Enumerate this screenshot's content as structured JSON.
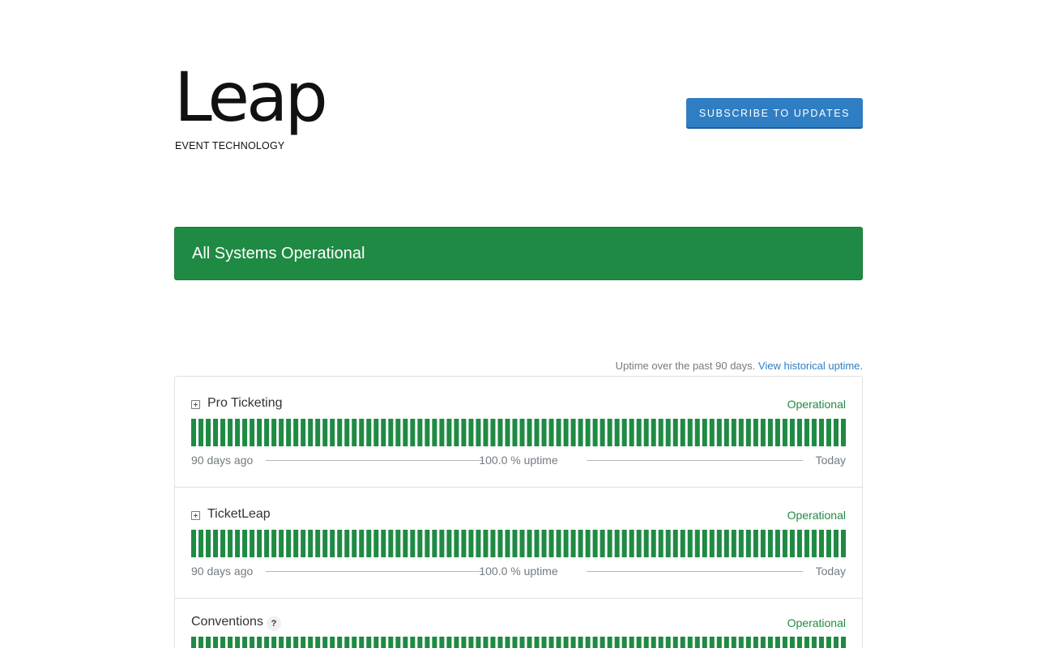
{
  "brand": {
    "logo_word": "Leap",
    "logo_sub": "EVENT TECHNOLOGY"
  },
  "header": {
    "subscribe_label": "SUBSCRIBE TO UPDATES"
  },
  "status": {
    "message": "All Systems Operational",
    "color": "#1f8a43"
  },
  "uptime": {
    "caption": "Uptime over the past 90 days.",
    "link_label": "View historical uptime."
  },
  "colors": {
    "operational": "#1f8a43",
    "accent": "#2f7ec4"
  },
  "components": [
    {
      "name": "Pro Ticketing",
      "status": "Operational",
      "expandable": true,
      "has_help": false,
      "days": 90,
      "left_label": "90 days ago",
      "uptime_label": "100.0 % uptime",
      "right_label": "Today"
    },
    {
      "name": "TicketLeap",
      "status": "Operational",
      "expandable": true,
      "has_help": false,
      "days": 90,
      "left_label": "90 days ago",
      "uptime_label": "100.0 % uptime",
      "right_label": "Today"
    },
    {
      "name": "Conventions",
      "status": "Operational",
      "expandable": false,
      "has_help": true,
      "help_label": "?",
      "days": 90
    }
  ]
}
